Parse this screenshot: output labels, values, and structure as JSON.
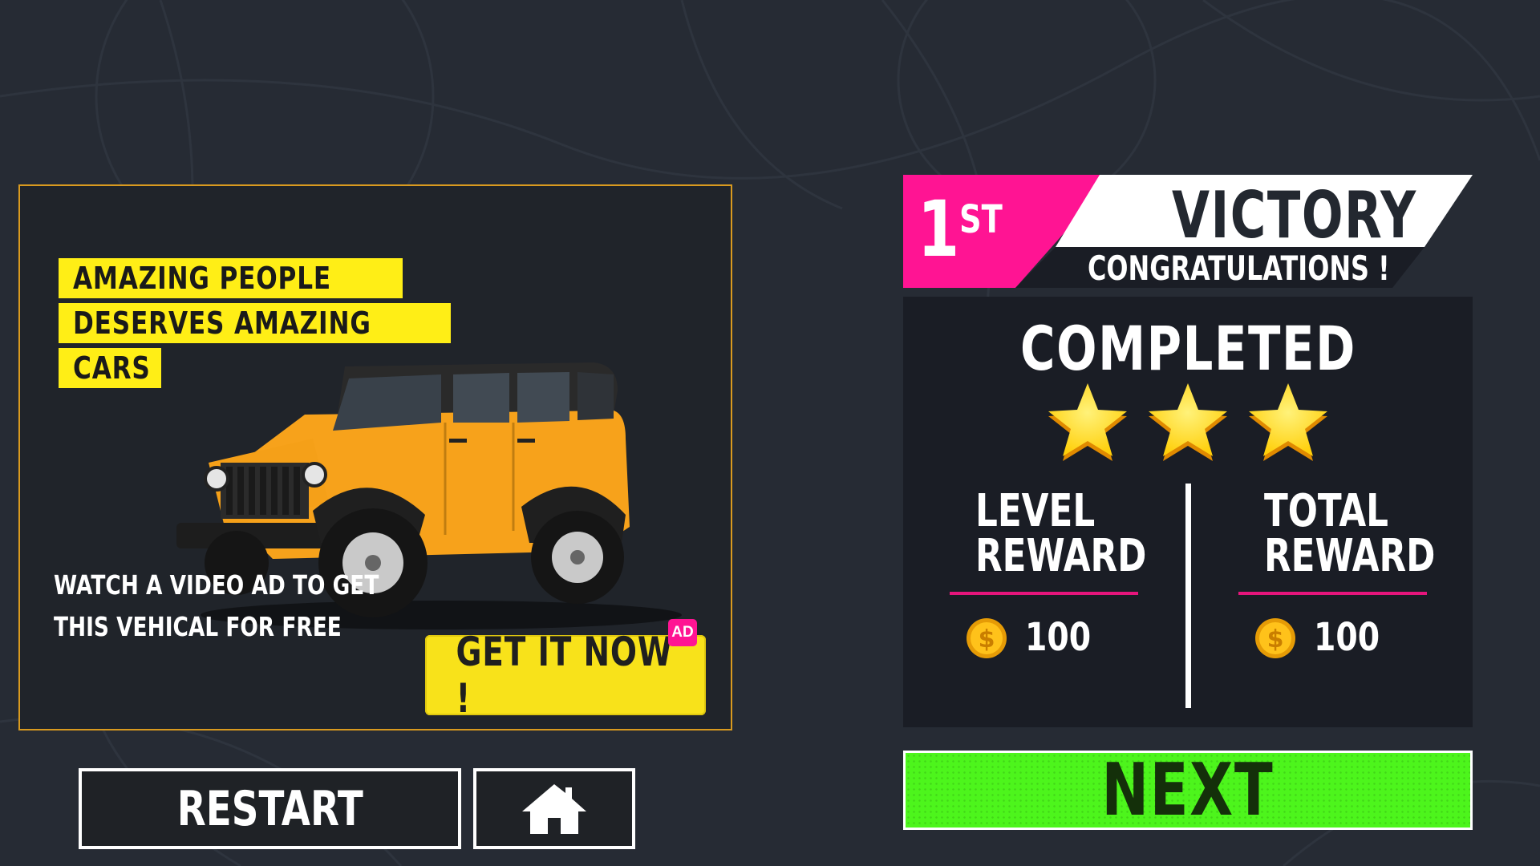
{
  "ad": {
    "tagline": [
      "AMAZING PEOPLE",
      "DESERVES AMAZING",
      "CARS"
    ],
    "description": [
      "WATCH A VIDEO AD TO GET",
      "THIS VEHICAL FOR FREE"
    ],
    "cta_label": "GET IT NOW !",
    "badge": "AD",
    "vehicle_color": "#f7a21b"
  },
  "buttons": {
    "restart_label": "RESTART",
    "home_icon": "home-icon",
    "next_label": "NEXT"
  },
  "result": {
    "place_number": "1",
    "place_suffix": "ST",
    "title": "VICTORY",
    "subtitle": "CONGRATULATIONS !",
    "status": "COMPLETED",
    "stars_earned": 3,
    "stars_total": 3,
    "rewards": [
      {
        "label_line1": "LEVEL",
        "label_line2": "REWARD",
        "value": "100",
        "icon": "coin-icon"
      },
      {
        "label_line1": "TOTAL",
        "label_line2": "REWARD",
        "value": "100",
        "icon": "coin-icon"
      }
    ]
  },
  "colors": {
    "background": "#262b34",
    "accent_pink": "#ff1493",
    "ad_yellow": "#ffee16",
    "next_green": "#4df51c",
    "star_yellow": "#ffe81a"
  }
}
